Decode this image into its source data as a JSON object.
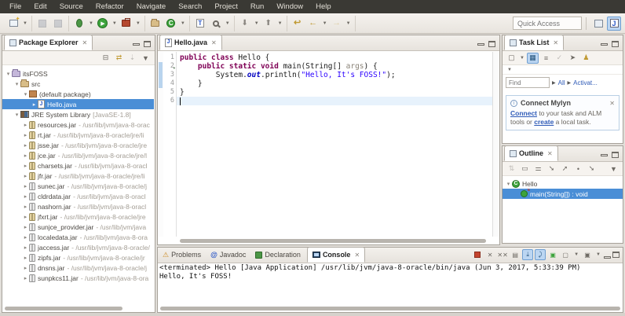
{
  "menu": {
    "items": [
      "File",
      "Edit",
      "Source",
      "Refactor",
      "Navigate",
      "Search",
      "Project",
      "Run",
      "Window",
      "Help"
    ]
  },
  "toolbar": {
    "quick_access_placeholder": "Quick Access"
  },
  "package_explorer": {
    "title": "Package Explorer",
    "items": [
      {
        "depth": 0,
        "exp": "open",
        "icon": "project",
        "name": "itsFOSS"
      },
      {
        "depth": 1,
        "exp": "open",
        "icon": "src",
        "name": "src"
      },
      {
        "depth": 2,
        "exp": "open",
        "icon": "package",
        "name": "(default package)"
      },
      {
        "depth": 3,
        "exp": "closed",
        "icon": "java",
        "name": "Hello.java",
        "selected": true
      },
      {
        "depth": 1,
        "exp": "open",
        "icon": "library",
        "name": "JRE System Library",
        "path": "[JavaSE-1.8]"
      },
      {
        "depth": 2,
        "exp": "closed",
        "icon": "jargold",
        "name": "resources.jar",
        "path": "- /usr/lib/jvm/java-8-orac"
      },
      {
        "depth": 2,
        "exp": "closed",
        "icon": "jargold",
        "name": "rt.jar",
        "path": "- /usr/lib/jvm/java-8-oracle/jre/li"
      },
      {
        "depth": 2,
        "exp": "closed",
        "icon": "jargold",
        "name": "jsse.jar",
        "path": "- /usr/lib/jvm/java-8-oracle/jre"
      },
      {
        "depth": 2,
        "exp": "closed",
        "icon": "jargold",
        "name": "jce.jar",
        "path": "- /usr/lib/jvm/java-8-oracle/jre/l"
      },
      {
        "depth": 2,
        "exp": "closed",
        "icon": "jargold",
        "name": "charsets.jar",
        "path": "- /usr/lib/jvm/java-8-oracl"
      },
      {
        "depth": 2,
        "exp": "closed",
        "icon": "jargold",
        "name": "jfr.jar",
        "path": "- /usr/lib/jvm/java-8-oracle/jre/li"
      },
      {
        "depth": 2,
        "exp": "closed",
        "icon": "jarsilver",
        "name": "sunec.jar",
        "path": "- /usr/lib/jvm/java-8-oracle/j"
      },
      {
        "depth": 2,
        "exp": "closed",
        "icon": "jarsilver",
        "name": "cldrdata.jar",
        "path": "- /usr/lib/jvm/java-8-oracl"
      },
      {
        "depth": 2,
        "exp": "closed",
        "icon": "jarsilver",
        "name": "nashorn.jar",
        "path": "- /usr/lib/jvm/java-8-oracl"
      },
      {
        "depth": 2,
        "exp": "closed",
        "icon": "jargold",
        "name": "jfxrt.jar",
        "path": "- /usr/lib/jvm/java-8-oracle/jre"
      },
      {
        "depth": 2,
        "exp": "closed",
        "icon": "jarsilver",
        "name": "sunjce_provider.jar",
        "path": "- /usr/lib/jvm/java"
      },
      {
        "depth": 2,
        "exp": "closed",
        "icon": "jarsilver",
        "name": "localedata.jar",
        "path": "- /usr/lib/jvm/java-8-ora"
      },
      {
        "depth": 2,
        "exp": "closed",
        "icon": "jarsilver",
        "name": "jaccess.jar",
        "path": "- /usr/lib/jvm/java-8-oracle/"
      },
      {
        "depth": 2,
        "exp": "closed",
        "icon": "jarsilver",
        "name": "zipfs.jar",
        "path": "- /usr/lib/jvm/java-8-oracle/jr"
      },
      {
        "depth": 2,
        "exp": "closed",
        "icon": "jarsilver",
        "name": "dnsns.jar",
        "path": "- /usr/lib/jvm/java-8-oracle/j"
      },
      {
        "depth": 2,
        "exp": "closed",
        "icon": "jarsilver",
        "name": "sunpkcs11.jar",
        "path": "- /usr/lib/jvm/java-8-ora"
      }
    ]
  },
  "editor": {
    "tab_title": "Hello.java",
    "lines": [
      {
        "n": "1",
        "segs": [
          {
            "t": "public class",
            "c": "kw"
          },
          {
            "t": " Hello {",
            "c": "pl"
          }
        ]
      },
      {
        "n": "2",
        "marker": true,
        "segs": [
          {
            "t": "    ",
            "c": "pl"
          },
          {
            "t": "public static void",
            "c": "kw"
          },
          {
            "t": " main(String[] ",
            "c": "pl"
          },
          {
            "t": "args",
            "c": "arg"
          },
          {
            "t": ") {",
            "c": "pl"
          }
        ]
      },
      {
        "n": "3",
        "segs": [
          {
            "t": "        System.",
            "c": "pl"
          },
          {
            "t": "out",
            "c": "fld"
          },
          {
            "t": ".println(",
            "c": "pl"
          },
          {
            "t": "\"Hello, It's FOSS!\"",
            "c": "str"
          },
          {
            "t": ");",
            "c": "pl"
          }
        ]
      },
      {
        "n": "4",
        "segs": [
          {
            "t": "    }",
            "c": "pl"
          }
        ]
      },
      {
        "n": "5",
        "segs": [
          {
            "t": "}",
            "c": "pl"
          }
        ]
      },
      {
        "n": "6",
        "current": true,
        "segs": []
      }
    ]
  },
  "task_list": {
    "title": "Task List",
    "find_placeholder": "Find",
    "filter_links": [
      "All",
      "Activat..."
    ],
    "mylyn": {
      "title": "Connect Mylyn",
      "body": [
        {
          "t": "Connect",
          "link": true
        },
        {
          "t": " to your task and ALM tools or "
        },
        {
          "t": "create",
          "link": true
        },
        {
          "t": " a local task."
        }
      ]
    }
  },
  "outline": {
    "title": "Outline",
    "items": [
      {
        "depth": 0,
        "exp": "open",
        "icon": "class",
        "name": "Hello"
      },
      {
        "depth": 1,
        "exp": "none",
        "icon": "method",
        "name": "main(String[]) : void",
        "selected": true
      }
    ]
  },
  "console": {
    "tabs": [
      {
        "label": "Problems",
        "icon": "problems"
      },
      {
        "label": "Javadoc",
        "icon": "javadoc"
      },
      {
        "label": "Declaration",
        "icon": "decl"
      },
      {
        "label": "Console",
        "icon": "console",
        "active": true
      }
    ],
    "header": "<terminated> Hello [Java Application] /usr/lib/jvm/java-8-oracle/bin/java (Jun 3, 2017, 5:33:39 PM)",
    "output": "Hello, It's FOSS!"
  }
}
